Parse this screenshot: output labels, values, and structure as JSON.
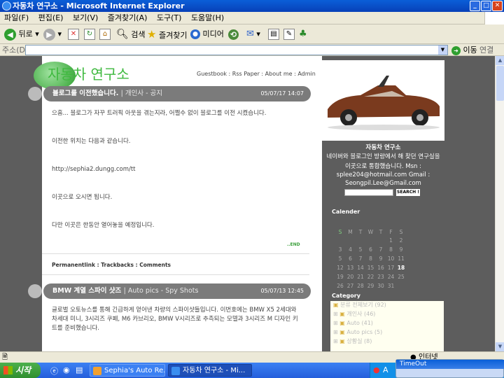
{
  "window": {
    "title": "자동차 연구소 - Microsoft Internet Explorer",
    "controls": {
      "minimize": "_",
      "maximize": "□",
      "close": "✕"
    }
  },
  "menu": [
    "파일(F)",
    "편집(E)",
    "보기(V)",
    "즐겨찾기(A)",
    "도구(T)",
    "도움말(H)"
  ],
  "toolbar": {
    "back": "뒤로",
    "search": "검색",
    "favorites": "즐겨찾기",
    "media": "미디어"
  },
  "address": {
    "label": "주소(D)",
    "value": "",
    "go": "이동",
    "links": "연결"
  },
  "blog": {
    "title": "자동차 연구소",
    "nav": "Guestbook : Rss Paper : About me : Admin",
    "posts": [
      {
        "title": "블로그를 이전했습니다.",
        "category": "| 개인사 - 공지",
        "date": "05/07/17 14:07",
        "paragraphs": [
          "으흠... 블로그가 자꾸 트러픽 아웃을 겪는지라, 어쩔수 없이 블로그를 이전 시켰습니다.",
          "이전한 위치는 다음과 같습니다.",
          "http://sephia2.dungg.com/tt",
          "이곳으로 오시면 됩니다.",
          "다만 이곳은 한동안 열어놓을 예정입니다."
        ],
        "end": "..END",
        "footer": "Permanentlink : Trackbacks : Comments"
      },
      {
        "title": "BMW 계열 스파이 샷즈",
        "category": "| Auto pics - Spy Shots",
        "date": "05/07/13 12:45",
        "paragraphs": [
          "글로벌 오토뉴스를 통해 긴급하게 얻어낸 차량의 스파이샷들입니다. 이번호에는 BMW X5 2세대와 차세대 미니, 3시리즈 쿠페, M6 카브리오, BMW V시리즈로 추측되는 모델과 3시리즈 M 디자인 키트를 준비했습니다."
        ]
      }
    ]
  },
  "sidebar": {
    "name": "자동차 연구소",
    "desc": [
      "네이버와 블로그인 방랑에서 해 찾던 연구실을",
      "이곳으로 통합했습니다. Msn :",
      "splee204@hotmail.com Gmail :",
      "Seongpil.Lee@Gmail.com"
    ],
    "search_btn": "SEARCH !",
    "calendar_title": "Calender",
    "calendar": {
      "days": [
        "S",
        "M",
        "T",
        "W",
        "T",
        "F",
        "S"
      ],
      "weeks": [
        [
          "",
          "",
          "",
          "",
          "",
          "1",
          "2"
        ],
        [
          "3",
          "4",
          "5",
          "6",
          "7",
          "8",
          "9"
        ],
        [
          "5",
          "6",
          "7",
          "8",
          "9",
          "10",
          "11"
        ],
        [
          "12",
          "13",
          "14",
          "15",
          "16",
          "17",
          "18"
        ],
        [
          "19",
          "20",
          "21",
          "22",
          "23",
          "24",
          "25"
        ],
        [
          "26",
          "27",
          "28",
          "29",
          "30",
          "31",
          ""
        ]
      ]
    },
    "category_title": "Category",
    "categories": [
      "분류 전체보기 (92)",
      "개인사 (46)",
      "Auto (41)",
      "Auto pics (5)",
      "상황실 (8)"
    ]
  },
  "status": {
    "zone": "인터넷"
  },
  "taskbar": {
    "start": "시작",
    "tasks": [
      "Sephia's Auto Re...",
      "자동차 연구소 - Mi..."
    ],
    "balloon": "TimeOut"
  }
}
